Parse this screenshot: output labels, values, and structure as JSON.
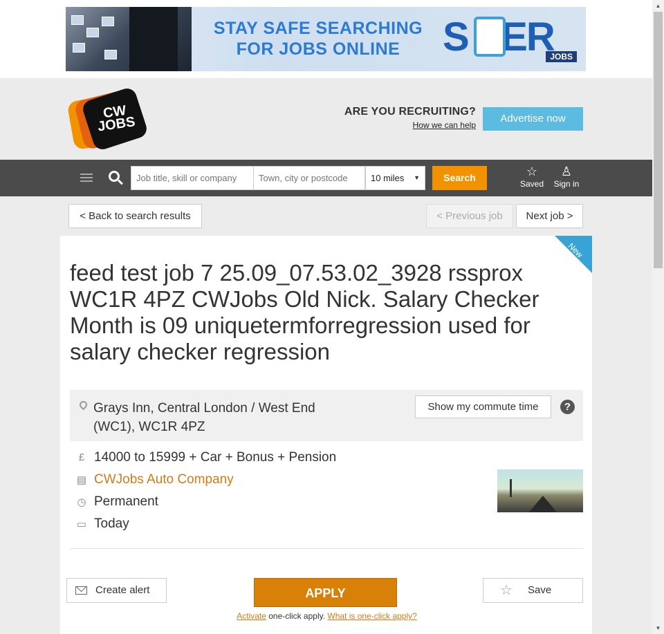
{
  "banner": {
    "headline_line1": "STAY SAFE SEARCHING",
    "headline_line2": "FOR JOBS ONLINE",
    "brand_word": "S  FER",
    "brand_sub": "JOBS"
  },
  "header": {
    "logo_text": "CW\nJOBS",
    "recruiting_question": "ARE YOU RECRUITING?",
    "how_we_can_help": "How we can help",
    "advertise_label": "Advertise now"
  },
  "search": {
    "job_placeholder": "Job title, skill or company",
    "town_placeholder": "Town, city or postcode",
    "distance_value": "10 miles",
    "search_label": "Search",
    "saved_label": "Saved",
    "signin_label": "Sign in"
  },
  "pager": {
    "back_label": "< Back to search results",
    "previous_label": "< Previous job",
    "next_label": "Next job >"
  },
  "job": {
    "new_badge": "New",
    "title": "feed test job 7 25.09_07.53.02_3928 rssprox WC1R 4PZ CWJobs Old Nick. Salary Checker Month is 09 uniquetermforregression used for salary checker regression",
    "location_line1": "Grays Inn, Central London / West End",
    "location_line2": "(WC1), WC1R 4PZ",
    "commute_label": "Show my commute time",
    "help_glyph": "?",
    "salary": "14000 to 15999 + Car + Bonus + Pension",
    "company": "CWJobs Auto Company",
    "job_type": "Permanent",
    "posted": "Today"
  },
  "actions": {
    "create_alert_label": "Create alert",
    "apply_label": "APPLY",
    "save_label": "Save",
    "activate_link": "Activate",
    "one_click_text": " one-click apply. ",
    "what_is_link": "What is one-click apply?"
  },
  "icons": {
    "pound": "£",
    "company": "▤",
    "type": "◷",
    "date": "▭",
    "star": "☆",
    "person": "♙"
  },
  "colors": {
    "accent_orange": "#f39200",
    "apply_orange": "#d98009",
    "advertise_blue": "#5bbbe0",
    "nav_grey": "#4b4b4b",
    "link_orange": "#d67a15"
  }
}
